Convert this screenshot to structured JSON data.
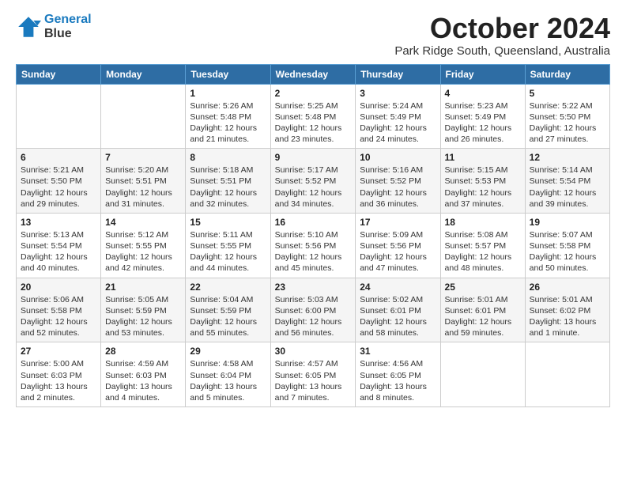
{
  "logo": {
    "line1": "General",
    "line2": "Blue"
  },
  "title": "October 2024",
  "subtitle": "Park Ridge South, Queensland, Australia",
  "days_of_week": [
    "Sunday",
    "Monday",
    "Tuesday",
    "Wednesday",
    "Thursday",
    "Friday",
    "Saturday"
  ],
  "weeks": [
    [
      {
        "day": "",
        "info": ""
      },
      {
        "day": "",
        "info": ""
      },
      {
        "day": "1",
        "info": "Sunrise: 5:26 AM\nSunset: 5:48 PM\nDaylight: 12 hours and 21 minutes."
      },
      {
        "day": "2",
        "info": "Sunrise: 5:25 AM\nSunset: 5:48 PM\nDaylight: 12 hours and 23 minutes."
      },
      {
        "day": "3",
        "info": "Sunrise: 5:24 AM\nSunset: 5:49 PM\nDaylight: 12 hours and 24 minutes."
      },
      {
        "day": "4",
        "info": "Sunrise: 5:23 AM\nSunset: 5:49 PM\nDaylight: 12 hours and 26 minutes."
      },
      {
        "day": "5",
        "info": "Sunrise: 5:22 AM\nSunset: 5:50 PM\nDaylight: 12 hours and 27 minutes."
      }
    ],
    [
      {
        "day": "6",
        "info": "Sunrise: 5:21 AM\nSunset: 5:50 PM\nDaylight: 12 hours and 29 minutes."
      },
      {
        "day": "7",
        "info": "Sunrise: 5:20 AM\nSunset: 5:51 PM\nDaylight: 12 hours and 31 minutes."
      },
      {
        "day": "8",
        "info": "Sunrise: 5:18 AM\nSunset: 5:51 PM\nDaylight: 12 hours and 32 minutes."
      },
      {
        "day": "9",
        "info": "Sunrise: 5:17 AM\nSunset: 5:52 PM\nDaylight: 12 hours and 34 minutes."
      },
      {
        "day": "10",
        "info": "Sunrise: 5:16 AM\nSunset: 5:52 PM\nDaylight: 12 hours and 36 minutes."
      },
      {
        "day": "11",
        "info": "Sunrise: 5:15 AM\nSunset: 5:53 PM\nDaylight: 12 hours and 37 minutes."
      },
      {
        "day": "12",
        "info": "Sunrise: 5:14 AM\nSunset: 5:54 PM\nDaylight: 12 hours and 39 minutes."
      }
    ],
    [
      {
        "day": "13",
        "info": "Sunrise: 5:13 AM\nSunset: 5:54 PM\nDaylight: 12 hours and 40 minutes."
      },
      {
        "day": "14",
        "info": "Sunrise: 5:12 AM\nSunset: 5:55 PM\nDaylight: 12 hours and 42 minutes."
      },
      {
        "day": "15",
        "info": "Sunrise: 5:11 AM\nSunset: 5:55 PM\nDaylight: 12 hours and 44 minutes."
      },
      {
        "day": "16",
        "info": "Sunrise: 5:10 AM\nSunset: 5:56 PM\nDaylight: 12 hours and 45 minutes."
      },
      {
        "day": "17",
        "info": "Sunrise: 5:09 AM\nSunset: 5:56 PM\nDaylight: 12 hours and 47 minutes."
      },
      {
        "day": "18",
        "info": "Sunrise: 5:08 AM\nSunset: 5:57 PM\nDaylight: 12 hours and 48 minutes."
      },
      {
        "day": "19",
        "info": "Sunrise: 5:07 AM\nSunset: 5:58 PM\nDaylight: 12 hours and 50 minutes."
      }
    ],
    [
      {
        "day": "20",
        "info": "Sunrise: 5:06 AM\nSunset: 5:58 PM\nDaylight: 12 hours and 52 minutes."
      },
      {
        "day": "21",
        "info": "Sunrise: 5:05 AM\nSunset: 5:59 PM\nDaylight: 12 hours and 53 minutes."
      },
      {
        "day": "22",
        "info": "Sunrise: 5:04 AM\nSunset: 5:59 PM\nDaylight: 12 hours and 55 minutes."
      },
      {
        "day": "23",
        "info": "Sunrise: 5:03 AM\nSunset: 6:00 PM\nDaylight: 12 hours and 56 minutes."
      },
      {
        "day": "24",
        "info": "Sunrise: 5:02 AM\nSunset: 6:01 PM\nDaylight: 12 hours and 58 minutes."
      },
      {
        "day": "25",
        "info": "Sunrise: 5:01 AM\nSunset: 6:01 PM\nDaylight: 12 hours and 59 minutes."
      },
      {
        "day": "26",
        "info": "Sunrise: 5:01 AM\nSunset: 6:02 PM\nDaylight: 13 hours and 1 minute."
      }
    ],
    [
      {
        "day": "27",
        "info": "Sunrise: 5:00 AM\nSunset: 6:03 PM\nDaylight: 13 hours and 2 minutes."
      },
      {
        "day": "28",
        "info": "Sunrise: 4:59 AM\nSunset: 6:03 PM\nDaylight: 13 hours and 4 minutes."
      },
      {
        "day": "29",
        "info": "Sunrise: 4:58 AM\nSunset: 6:04 PM\nDaylight: 13 hours and 5 minutes."
      },
      {
        "day": "30",
        "info": "Sunrise: 4:57 AM\nSunset: 6:05 PM\nDaylight: 13 hours and 7 minutes."
      },
      {
        "day": "31",
        "info": "Sunrise: 4:56 AM\nSunset: 6:05 PM\nDaylight: 13 hours and 8 minutes."
      },
      {
        "day": "",
        "info": ""
      },
      {
        "day": "",
        "info": ""
      }
    ]
  ]
}
